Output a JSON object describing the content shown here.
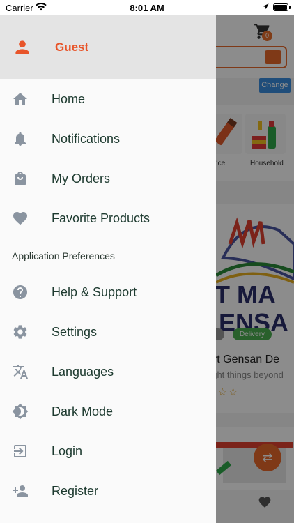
{
  "status_bar": {
    "carrier": "Carrier",
    "time": "8:01 AM"
  },
  "drawer": {
    "guest_label": "Guest",
    "items": [
      {
        "label": "Home",
        "icon": "home-icon"
      },
      {
        "label": "Notifications",
        "icon": "bell-icon"
      },
      {
        "label": "My Orders",
        "icon": "shopping-bag-icon"
      },
      {
        "label": "Favorite Products",
        "icon": "heart-icon"
      }
    ],
    "section_title": "Application Preferences",
    "pref_items": [
      {
        "label": "Help & Support",
        "icon": "help-icon"
      },
      {
        "label": "Settings",
        "icon": "gear-icon"
      },
      {
        "label": "Languages",
        "icon": "translate-icon"
      },
      {
        "label": "Dark Mode",
        "icon": "brightness-icon"
      },
      {
        "label": "Login",
        "icon": "login-icon"
      },
      {
        "label": "Register",
        "icon": "person-add-icon"
      }
    ]
  },
  "background": {
    "cart_count": "0",
    "change_label": "Change",
    "categories": [
      "ffice",
      "Household"
    ],
    "delivery_label": "Delivery",
    "store_name": "art Gensan De",
    "store_tagline": "right things beyond",
    "stars": "☆☆☆"
  },
  "colors": {
    "accent": "#e8552a",
    "header_bg": "#e4e4e4",
    "icon_grey": "#8a94a0",
    "label_text": "#1d3a2f"
  }
}
